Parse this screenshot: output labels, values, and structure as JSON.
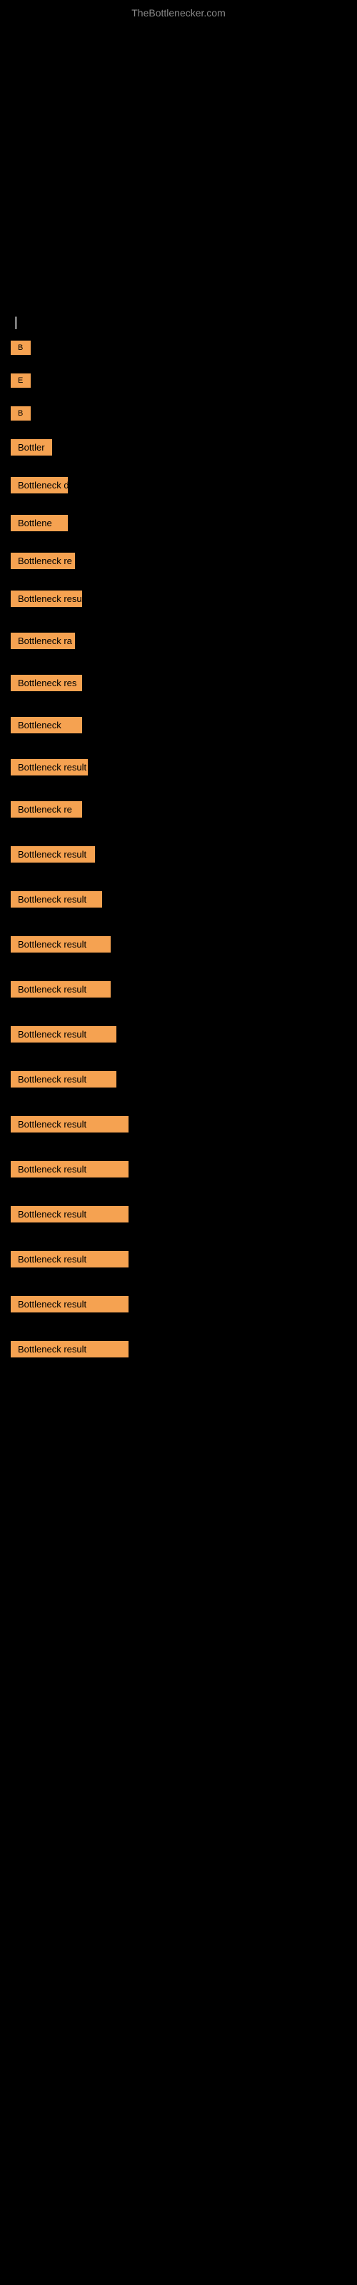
{
  "site": {
    "title": "TheBottlenecker.com"
  },
  "section": {
    "label": "|"
  },
  "items": [
    {
      "id": 1,
      "label": "B",
      "size_class": "size-xs"
    },
    {
      "id": 2,
      "label": "E",
      "size_class": "size-xs"
    },
    {
      "id": 3,
      "label": "B",
      "size_class": "size-xs"
    },
    {
      "id": 4,
      "label": "Bottler",
      "size_class": "size-md0"
    },
    {
      "id": 5,
      "label": "Bottleneck d",
      "size_class": "size-md1"
    },
    {
      "id": 6,
      "label": "Bottlene",
      "size_class": "size-md1"
    },
    {
      "id": 7,
      "label": "Bottleneck re",
      "size_class": "size-md2"
    },
    {
      "id": 8,
      "label": "Bottleneck resul",
      "size_class": "size-md3"
    },
    {
      "id": 9,
      "label": "Bottleneck ra",
      "size_class": "size-md2"
    },
    {
      "id": 10,
      "label": "Bottleneck res",
      "size_class": "size-md3"
    },
    {
      "id": 11,
      "label": "Bottleneck",
      "size_class": "size-md3"
    },
    {
      "id": 12,
      "label": "Bottleneck result",
      "size_class": "size-md4"
    },
    {
      "id": 13,
      "label": "Bottleneck re",
      "size_class": "size-md3"
    },
    {
      "id": 14,
      "label": "Bottleneck result",
      "size_class": "size-md5"
    },
    {
      "id": 15,
      "label": "Bottleneck result",
      "size_class": "size-lg1"
    },
    {
      "id": 16,
      "label": "Bottleneck result",
      "size_class": "size-lg2"
    },
    {
      "id": 17,
      "label": "Bottleneck result",
      "size_class": "size-lg2"
    },
    {
      "id": 18,
      "label": "Bottleneck result",
      "size_class": "size-lg3"
    },
    {
      "id": 19,
      "label": "Bottleneck result",
      "size_class": "size-lg3"
    },
    {
      "id": 20,
      "label": "Bottleneck result",
      "size_class": "size-full"
    },
    {
      "id": 21,
      "label": "Bottleneck result",
      "size_class": "size-full"
    },
    {
      "id": 22,
      "label": "Bottleneck result",
      "size_class": "size-full"
    },
    {
      "id": 23,
      "label": "Bottleneck result",
      "size_class": "size-full"
    },
    {
      "id": 24,
      "label": "Bottleneck result",
      "size_class": "size-full"
    },
    {
      "id": 25,
      "label": "Bottleneck result",
      "size_class": "size-full"
    }
  ]
}
